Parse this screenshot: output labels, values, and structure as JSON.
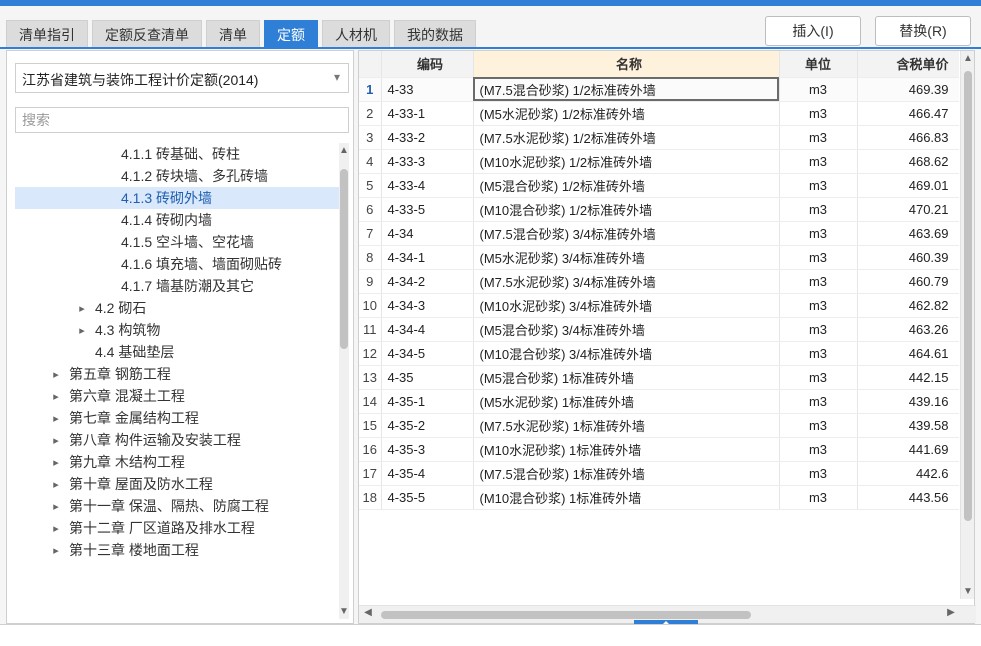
{
  "tabs": [
    {
      "label": "清单指引",
      "active": false
    },
    {
      "label": "定额反查清单",
      "active": false
    },
    {
      "label": "清单",
      "active": false
    },
    {
      "label": "定额",
      "active": true
    },
    {
      "label": "人材机",
      "active": false
    },
    {
      "label": "我的数据",
      "active": false
    }
  ],
  "actions": {
    "insert_label": "插入(I)",
    "replace_label": "替换(R)"
  },
  "left_panel": {
    "library": "江苏省建筑与装饰工程计价定额(2014)",
    "search_placeholder": "搜索",
    "tree": [
      {
        "label": "4.1.1 砖基础、砖柱",
        "level": 2,
        "expandable": false,
        "active": false
      },
      {
        "label": "4.1.2 砖块墙、多孔砖墙",
        "level": 2,
        "expandable": false,
        "active": false
      },
      {
        "label": "4.1.3 砖砌外墙",
        "level": 2,
        "expandable": false,
        "active": true
      },
      {
        "label": "4.1.4 砖砌内墙",
        "level": 2,
        "expandable": false,
        "active": false
      },
      {
        "label": "4.1.5 空斗墙、空花墙",
        "level": 2,
        "expandable": false,
        "active": false
      },
      {
        "label": "4.1.6 填充墙、墙面砌贴砖",
        "level": 2,
        "expandable": false,
        "active": false
      },
      {
        "label": "4.1.7 墙基防潮及其它",
        "level": 2,
        "expandable": false,
        "active": false
      },
      {
        "label": "4.2 砌石",
        "level": 1,
        "expandable": true,
        "active": false
      },
      {
        "label": "4.3 构筑物",
        "level": 1,
        "expandable": true,
        "active": false
      },
      {
        "label": "4.4 基础垫层",
        "level": 1,
        "expandable": false,
        "active": false
      },
      {
        "label": "第五章 钢筋工程",
        "level": 0,
        "expandable": true,
        "active": false
      },
      {
        "label": "第六章 混凝土工程",
        "level": 0,
        "expandable": true,
        "active": false
      },
      {
        "label": "第七章 金属结构工程",
        "level": 0,
        "expandable": true,
        "active": false
      },
      {
        "label": "第八章 构件运输及安装工程",
        "level": 0,
        "expandable": true,
        "active": false
      },
      {
        "label": "第九章 木结构工程",
        "level": 0,
        "expandable": true,
        "active": false
      },
      {
        "label": "第十章 屋面及防水工程",
        "level": 0,
        "expandable": true,
        "active": false
      },
      {
        "label": "第十一章 保温、隔热、防腐工程",
        "level": 0,
        "expandable": true,
        "active": false
      },
      {
        "label": "第十二章 厂区道路及排水工程",
        "level": 0,
        "expandable": true,
        "active": false
      },
      {
        "label": "第十三章 楼地面工程",
        "level": 0,
        "expandable": true,
        "active": false
      }
    ]
  },
  "grid": {
    "columns": [
      "编码",
      "名称",
      "单位",
      "含税单价"
    ],
    "rows": [
      {
        "num": "1",
        "code": "4-33",
        "name": "(M7.5混合砂浆) 1/2标准砖外墙",
        "unit": "m3",
        "price": "469.39"
      },
      {
        "num": "2",
        "code": "4-33-1",
        "name": "(M5水泥砂浆) 1/2标准砖外墙",
        "unit": "m3",
        "price": "466.47"
      },
      {
        "num": "3",
        "code": "4-33-2",
        "name": "(M7.5水泥砂浆) 1/2标准砖外墙",
        "unit": "m3",
        "price": "466.83"
      },
      {
        "num": "4",
        "code": "4-33-3",
        "name": "(M10水泥砂浆) 1/2标准砖外墙",
        "unit": "m3",
        "price": "468.62"
      },
      {
        "num": "5",
        "code": "4-33-4",
        "name": "(M5混合砂浆) 1/2标准砖外墙",
        "unit": "m3",
        "price": "469.01"
      },
      {
        "num": "6",
        "code": "4-33-5",
        "name": "(M10混合砂浆) 1/2标准砖外墙",
        "unit": "m3",
        "price": "470.21"
      },
      {
        "num": "7",
        "code": "4-34",
        "name": "(M7.5混合砂浆) 3/4标准砖外墙",
        "unit": "m3",
        "price": "463.69"
      },
      {
        "num": "8",
        "code": "4-34-1",
        "name": "(M5水泥砂浆) 3/4标准砖外墙",
        "unit": "m3",
        "price": "460.39"
      },
      {
        "num": "9",
        "code": "4-34-2",
        "name": "(M7.5水泥砂浆) 3/4标准砖外墙",
        "unit": "m3",
        "price": "460.79"
      },
      {
        "num": "10",
        "code": "4-34-3",
        "name": "(M10水泥砂浆) 3/4标准砖外墙",
        "unit": "m3",
        "price": "462.82"
      },
      {
        "num": "11",
        "code": "4-34-4",
        "name": "(M5混合砂浆) 3/4标准砖外墙",
        "unit": "m3",
        "price": "463.26"
      },
      {
        "num": "12",
        "code": "4-34-5",
        "name": "(M10混合砂浆) 3/4标准砖外墙",
        "unit": "m3",
        "price": "464.61"
      },
      {
        "num": "13",
        "code": "4-35",
        "name": "(M5混合砂浆) 1标准砖外墙",
        "unit": "m3",
        "price": "442.15"
      },
      {
        "num": "14",
        "code": "4-35-1",
        "name": "(M5水泥砂浆) 1标准砖外墙",
        "unit": "m3",
        "price": "439.16"
      },
      {
        "num": "15",
        "code": "4-35-2",
        "name": "(M7.5水泥砂浆) 1标准砖外墙",
        "unit": "m3",
        "price": "439.58"
      },
      {
        "num": "16",
        "code": "4-35-3",
        "name": "(M10水泥砂浆) 1标准砖外墙",
        "unit": "m3",
        "price": "441.69"
      },
      {
        "num": "17",
        "code": "4-35-4",
        "name": "(M7.5混合砂浆) 1标准砖外墙",
        "unit": "m3",
        "price": "442.6"
      },
      {
        "num": "18",
        "code": "4-35-5",
        "name": "(M10混合砂浆) 1标准砖外墙",
        "unit": "m3",
        "price": "443.56"
      }
    ]
  },
  "icons": {
    "dropdown": "chevron-down-icon",
    "tree_expand": "triangle-right-icon",
    "splitter": "chevron-up-icon"
  },
  "colors": {
    "accent": "#2f7fd6",
    "active_tree_bg": "#d9e8fb",
    "name_header_bg": "#fff2dc"
  }
}
